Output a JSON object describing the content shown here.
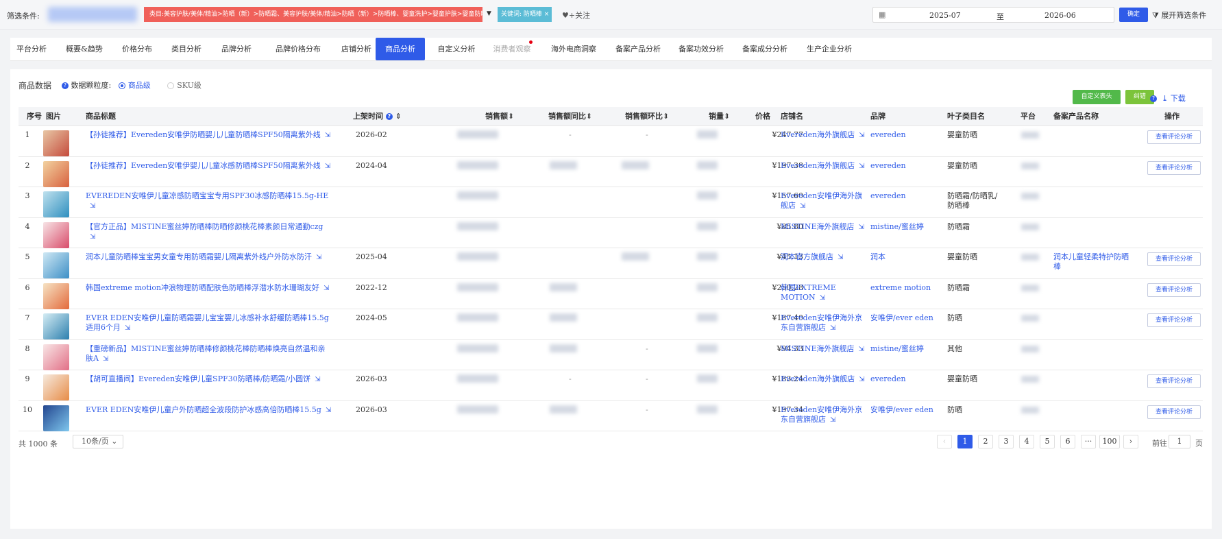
{
  "filter": {
    "label": "筛选条件:",
    "category": "类目:美容护肤/美体/精油>防晒（新）>防晒霜、美容护肤/美体/精油>防晒（新）>防晒棒、婴童洗护>婴童护肤>婴童防晒",
    "keyword": "关键词: 防晒棒",
    "follow": "+关注",
    "date_from": "2025-07",
    "date_sep": "至",
    "date_to": "2026-06",
    "confirm": "确定",
    "expand": "展开筛选条件"
  },
  "tabs": [
    {
      "label": "平台分析"
    },
    {
      "label": "概要&趋势"
    },
    {
      "label": "价格分布"
    },
    {
      "label": "类目分析"
    },
    {
      "label": "品牌分析"
    },
    {
      "label": "品牌价格分布"
    },
    {
      "label": "店铺分析"
    },
    {
      "label": "商品分析"
    },
    {
      "label": "自定义分析"
    },
    {
      "label": "消费者观察"
    },
    {
      "label": "海外电商洞察"
    },
    {
      "label": "备案产品分析"
    },
    {
      "label": "备案功效分析"
    },
    {
      "label": "备案成分分析"
    },
    {
      "label": "生产企业分析"
    }
  ],
  "section": {
    "title": "商品数据",
    "granularity_label": "数据颗粒度:",
    "opt_product": "商品级",
    "opt_sku": "SKU级",
    "custom_header": "自定义表头",
    "pin": "纠错",
    "download": "下载"
  },
  "columns": {
    "idx": "序号",
    "img": "图片",
    "title": "商品标题",
    "date": "上架时间",
    "sales": "销售额",
    "yoy": "销售额同比",
    "mom": "销售额环比",
    "volume": "销量",
    "price": "价格",
    "shop": "店铺名",
    "brand": "品牌",
    "leaf": "叶子类目名",
    "platform": "平台",
    "record": "备案产品名称",
    "op": "操作"
  },
  "rows": [
    {
      "idx": "1",
      "title": "【孙徒推荐】Evereden安唯伊防晒婴儿儿童防晒棒SPF50隔离紫外线",
      "date": "2026-02",
      "yoy": "-",
      "mom": "-",
      "price": "¥247.77",
      "shop": "Evereden海外旗舰店",
      "brand": "evereden",
      "leaf": "婴童防晒",
      "record": "",
      "op": "查看评论分析"
    },
    {
      "idx": "2",
      "title": "【孙徒推荐】Evereden安唯伊婴儿儿童冰感防晒棒SPF50隔离紫外线",
      "date": "2024-04",
      "yoy": "",
      "mom": "",
      "price": "¥197.38",
      "shop": "Evereden海外旗舰店",
      "brand": "evereden",
      "leaf": "婴童防晒",
      "record": "",
      "op": "查看评论分析"
    },
    {
      "idx": "3",
      "title": "EVEREDEN安唯伊儿童凉感防晒宝宝专用SPF30冰感防晒棒15.5g-HE",
      "date": "",
      "yoy": "",
      "mom": "",
      "price": "¥157.60",
      "shop": "Evereden安唯伊海外旗舰店",
      "brand": "evereden",
      "leaf": "防晒霜/防晒乳/防晒棒",
      "record": "",
      "op": ""
    },
    {
      "idx": "4",
      "title": "【官方正品】MISTINE蜜丝婷防晒棒防晒修颜桃花棒素颜日常通勤czg",
      "date": "",
      "yoy": "",
      "mom": "",
      "price": "¥85.80",
      "shop": "MISTINE海外旗舰店",
      "brand": "mistine/蜜丝婷",
      "leaf": "防晒霜",
      "record": "",
      "op": ""
    },
    {
      "idx": "5",
      "title": "润本儿童防晒棒宝宝男女童专用防晒霜婴儿隔离紫外线户外防水防汗",
      "date": "2025-04",
      "yoy": "",
      "mom": "",
      "price": "¥45.13",
      "shop": "润本官方旗舰店",
      "brand": "润本",
      "leaf": "婴童防晒",
      "record": "润本儿童轻柔特护防晒棒",
      "op": "查看评论分析"
    },
    {
      "idx": "6",
      "title": "韩国extreme motion冲浪物理防晒配肤色防晒棒浮潜水防水珊瑚友好",
      "date": "2022-12",
      "yoy": "",
      "mom": "",
      "price": "¥250.28",
      "shop": "韩国EXTREME MOTION",
      "brand": "extreme motion",
      "leaf": "防晒霜",
      "record": "",
      "op": "查看评论分析"
    },
    {
      "idx": "7",
      "title": "EVER EDEN安唯伊儿童防晒霜婴儿宝宝婴儿冰感补水舒缓防晒棒15.5g适用6个月",
      "date": "2024-05",
      "yoy": "",
      "mom": "",
      "price": "¥187.40",
      "shop": "Evereden安唯伊海外京东自营旗舰店",
      "brand": "安唯伊/ever eden",
      "leaf": "防晒",
      "record": "",
      "op": "查看评论分析"
    },
    {
      "idx": "8",
      "title": "【重磅新品】MISTINE蜜丝婷防晒棒修颜桃花棒防晒棒焕亮自然温和亲肤A",
      "date": "",
      "yoy": "",
      "mom": "-",
      "price": "¥94.33",
      "shop": "MISTINE海外旗舰店",
      "brand": "mistine/蜜丝婷",
      "leaf": "其他",
      "record": "",
      "op": ""
    },
    {
      "idx": "9",
      "title": "【胡可直播间】Evereden安唯伊儿童SPF30防晒棒/防晒霜/小圆饼",
      "date": "2026-03",
      "yoy": "-",
      "mom": "-",
      "price": "¥183.24",
      "shop": "Evereden海外旗舰店",
      "brand": "evereden",
      "leaf": "婴童防晒",
      "record": "",
      "op": "查看评论分析"
    },
    {
      "idx": "10",
      "title": "EVER EDEN安唯伊儿童户外防晒超全波段防护冰感高倍防晒棒15.5g",
      "date": "2026-03",
      "yoy": "-",
      "mom": "-",
      "price": "¥197.34",
      "shop": "Evereden安唯伊海外京东自营旗舰店",
      "brand": "安唯伊/ever eden",
      "leaf": "防晒",
      "record": "",
      "op": "查看评论分析"
    }
  ],
  "pager": {
    "total": "共 1000 条",
    "size": "10条/页",
    "pages": [
      "1",
      "2",
      "3",
      "4",
      "5",
      "6",
      "···",
      "100"
    ],
    "goto": "前往",
    "goto_val": "1",
    "unit": "页"
  }
}
